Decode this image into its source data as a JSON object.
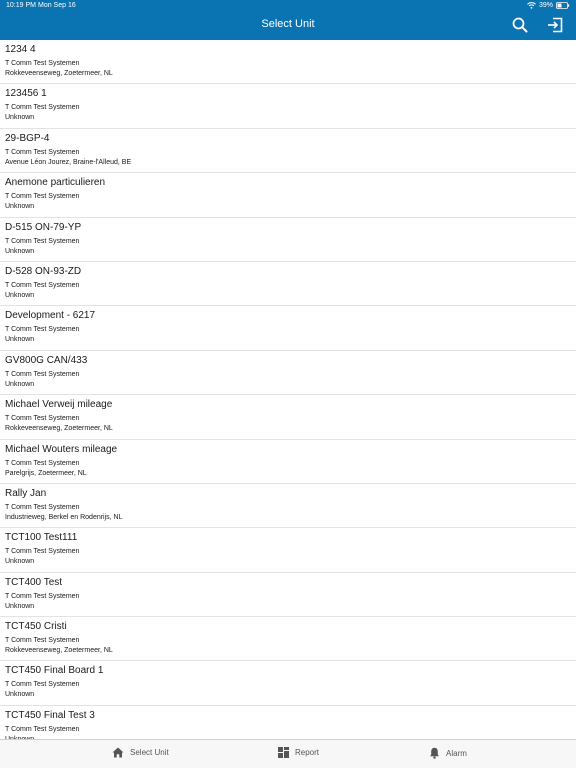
{
  "status": {
    "time": "10:19 PM",
    "date": "Mon Sep 16",
    "battery": "39%"
  },
  "header": {
    "title": "Select Unit",
    "search_icon": "search-icon",
    "logout_icon": "logout-icon"
  },
  "units": [
    {
      "name": "1234 4",
      "company": "T Comm Test Systemen",
      "address": "Rokkeveenseweg, Zoetermeer, NL"
    },
    {
      "name": "123456 1",
      "company": "T Comm Test Systemen",
      "address": "Unknown"
    },
    {
      "name": "29-BGP-4",
      "company": "T Comm Test Systemen",
      "address": "Avenue Léon Jourez, Braine-l'Alleud, BE"
    },
    {
      "name": "Anemone particulieren",
      "company": "T Comm Test Systemen",
      "address": "Unknown"
    },
    {
      "name": "D-515 ON-79-YP",
      "company": "T Comm Test Systemen",
      "address": "Unknown"
    },
    {
      "name": "D-528 ON-93-ZD",
      "company": "T Comm Test Systemen",
      "address": "Unknown"
    },
    {
      "name": "Development - 6217",
      "company": "T Comm Test Systemen",
      "address": "Unknown"
    },
    {
      "name": "GV800G CAN/433",
      "company": "T Comm Test Systemen",
      "address": "Unknown"
    },
    {
      "name": "Michael Verweij mileage",
      "company": "T Comm Test Systemen",
      "address": "Rokkeveenseweg, Zoetermeer, NL"
    },
    {
      "name": "Michael Wouters mileage",
      "company": "T Comm Test Systemen",
      "address": "Parelgrijs, Zoetermeer, NL"
    },
    {
      "name": "Rally Jan",
      "company": "T Comm Test Systemen",
      "address": "Industrieweg, Berkel en Rodenrijs, NL"
    },
    {
      "name": "TCT100 Test111",
      "company": "T Comm Test Systemen",
      "address": "Unknown"
    },
    {
      "name": "TCT400 Test",
      "company": "T Comm Test Systemen",
      "address": "Unknown"
    },
    {
      "name": "TCT450 Cristi",
      "company": "T Comm Test Systemen",
      "address": "Rokkeveenseweg, Zoetermeer, NL"
    },
    {
      "name": "TCT450 Final Board 1",
      "company": "T Comm Test Systemen",
      "address": "Unknown"
    },
    {
      "name": "TCT450 Final Test 3",
      "company": "T Comm Test Systemen",
      "address": "Unknown"
    }
  ],
  "tabbar": {
    "home_label": "Select Unit",
    "report_label": "Report",
    "alarm_label": "Alarm"
  },
  "colors": {
    "header_bg": "#0a73b1",
    "tabbar_bg": "#f7f7f7"
  }
}
